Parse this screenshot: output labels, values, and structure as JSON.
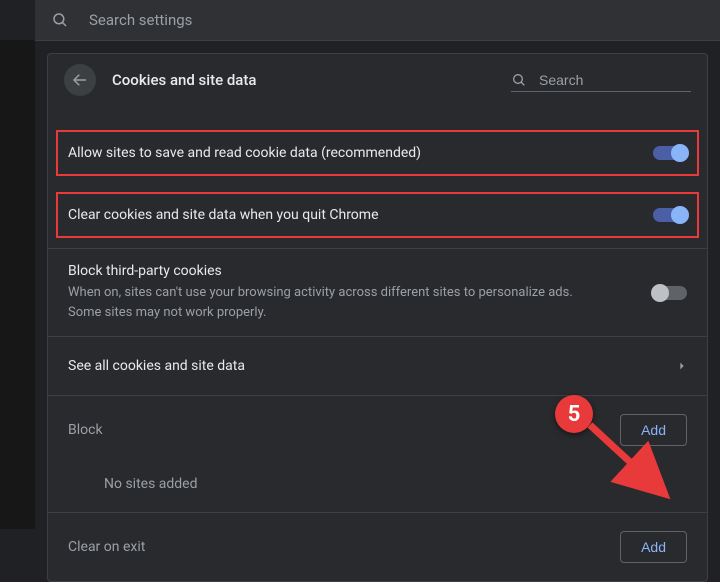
{
  "topbar": {
    "search_placeholder": "Search settings"
  },
  "header": {
    "title": "Cookies and site data",
    "search_placeholder": "Search"
  },
  "options": {
    "allow_cookies": {
      "label": "Allow sites to save and read cookie data (recommended)",
      "on": true,
      "highlighted": true
    },
    "clear_on_quit": {
      "label": "Clear cookies and site data when you quit Chrome",
      "on": true,
      "highlighted": true
    },
    "block_third_party": {
      "label": "Block third-party cookies",
      "sub": "When on, sites can't use your browsing activity across different sites to personalize ads. Some sites may not work properly.",
      "on": false
    },
    "see_all": {
      "label": "See all cookies and site data"
    }
  },
  "sections": {
    "block": {
      "title": "Block",
      "add_label": "Add",
      "empty_text": "No sites added"
    },
    "clear_on_exit": {
      "title": "Clear on exit",
      "add_label": "Add"
    }
  },
  "annotation": {
    "step_number": "5"
  }
}
